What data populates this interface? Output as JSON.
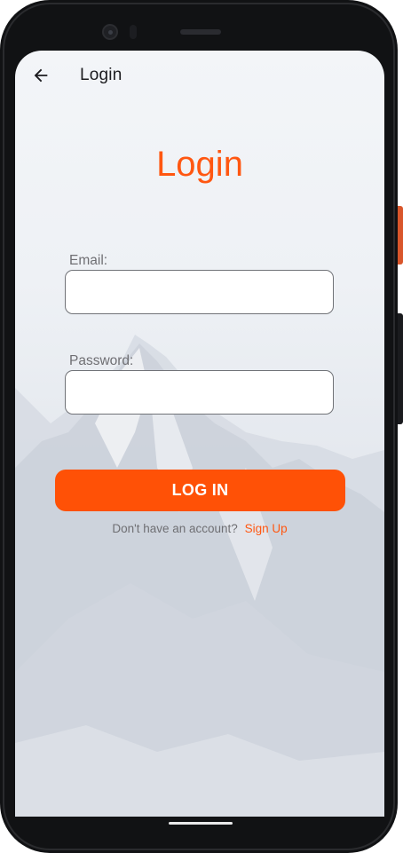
{
  "appbar": {
    "back_icon": "arrow-back-icon",
    "title": "Login"
  },
  "page": {
    "heading": "Login",
    "accent_color": "#ff5711"
  },
  "form": {
    "email_label": "Email:",
    "email_value": "",
    "password_label": "Password:",
    "password_value": "",
    "submit_label": "LOG IN"
  },
  "signup": {
    "prompt": "Don't have an account?",
    "link": "Sign Up"
  }
}
